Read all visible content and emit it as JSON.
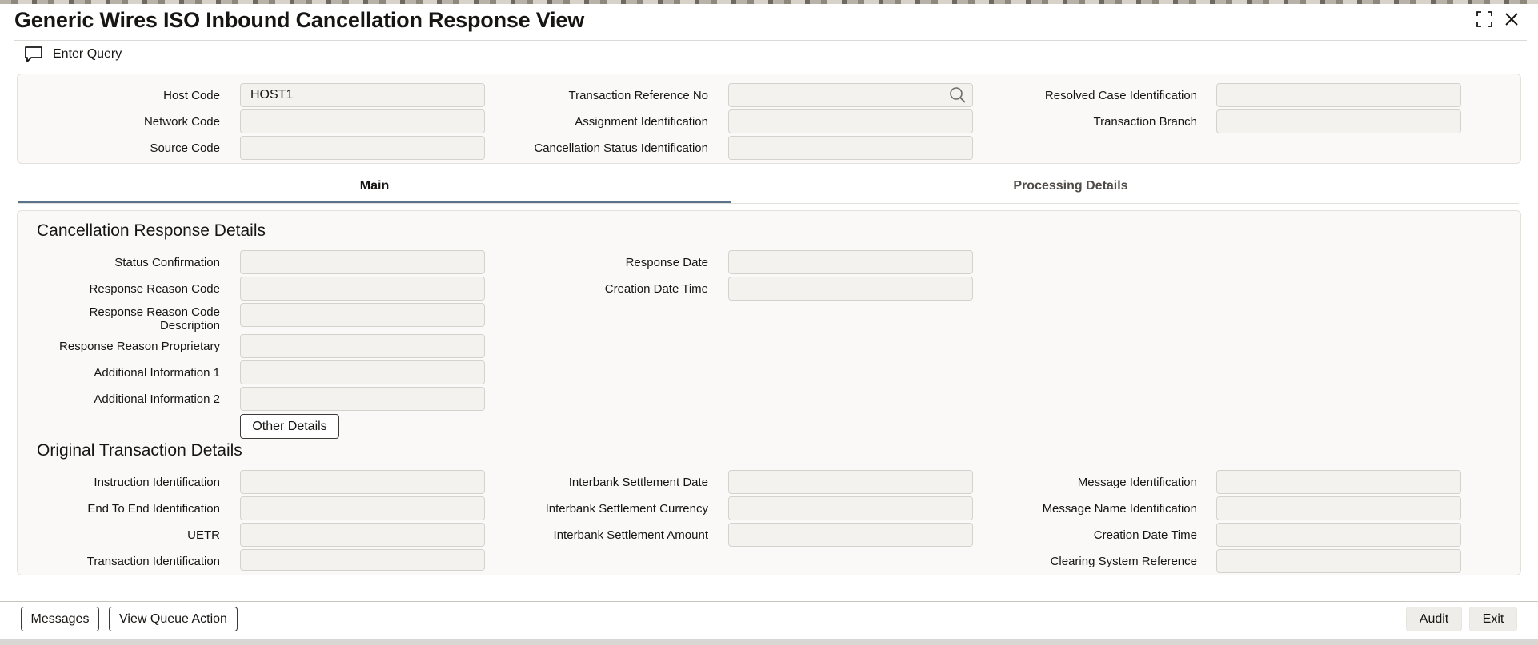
{
  "window": {
    "title": "Generic Wires ISO Inbound Cancellation Response View",
    "maximize_icon": "maximize-icon",
    "close_icon": "close-icon"
  },
  "toolbar": {
    "enter_query_label": "Enter Query",
    "enter_query_icon": "chat-bubble-icon"
  },
  "header": {
    "host_code": {
      "label": "Host Code",
      "value": "HOST1"
    },
    "network_code": {
      "label": "Network Code",
      "value": ""
    },
    "source_code": {
      "label": "Source Code",
      "value": ""
    },
    "transaction_reference_no": {
      "label": "Transaction Reference No",
      "value": "",
      "icon": "search-icon"
    },
    "assignment_identification": {
      "label": "Assignment Identification",
      "value": ""
    },
    "cancellation_status_identification": {
      "label": "Cancellation Status Identification",
      "value": ""
    },
    "resolved_case_identification": {
      "label": "Resolved Case Identification",
      "value": ""
    },
    "transaction_branch": {
      "label": "Transaction Branch",
      "value": ""
    }
  },
  "tabs": [
    {
      "label": "Main",
      "active": true
    },
    {
      "label": "Processing Details",
      "active": false
    }
  ],
  "cancellation_response": {
    "title": "Cancellation Response Details",
    "status_confirmation": {
      "label": "Status Confirmation",
      "value": ""
    },
    "response_reason_code": {
      "label": "Response Reason Code",
      "value": ""
    },
    "response_reason_code_description": {
      "label_line1": "Response Reason Code",
      "label_line2": "Description",
      "value": ""
    },
    "response_reason_proprietary": {
      "label": "Response Reason Proprietary",
      "value": ""
    },
    "additional_information_1": {
      "label": "Additional Information 1",
      "value": ""
    },
    "additional_information_2": {
      "label": "Additional Information 2",
      "value": ""
    },
    "other_details_button": "Other Details",
    "response_date": {
      "label": "Response Date",
      "value": ""
    },
    "creation_date_time": {
      "label": "Creation Date Time",
      "value": ""
    }
  },
  "original_transaction": {
    "title": "Original Transaction Details",
    "instruction_identification": {
      "label": "Instruction Identification",
      "value": ""
    },
    "end_to_end_identification": {
      "label": "End To End Identification",
      "value": ""
    },
    "uetr": {
      "label": "UETR",
      "value": ""
    },
    "transaction_identification": {
      "label": "Transaction Identification",
      "value": ""
    },
    "interbank_settlement_date": {
      "label": "Interbank Settlement Date",
      "value": ""
    },
    "interbank_settlement_currency": {
      "label": "Interbank Settlement Currency",
      "value": ""
    },
    "interbank_settlement_amount": {
      "label": "Interbank Settlement Amount",
      "value": ""
    },
    "message_identification": {
      "label": "Message Identification",
      "value": ""
    },
    "message_name_identification": {
      "label": "Message Name Identification",
      "value": ""
    },
    "creation_date_time": {
      "label": "Creation Date Time",
      "value": ""
    },
    "clearing_system_reference": {
      "label": "Clearing System Reference",
      "value": ""
    }
  },
  "footer": {
    "messages_button": "Messages",
    "view_queue_action_button": "View Queue Action",
    "audit_button": "Audit",
    "exit_button": "Exit"
  },
  "colors": {
    "tab_active_underline": "#5a738a",
    "panel_bg": "#fbf9f8",
    "field_bg": "#f4f2ef"
  }
}
